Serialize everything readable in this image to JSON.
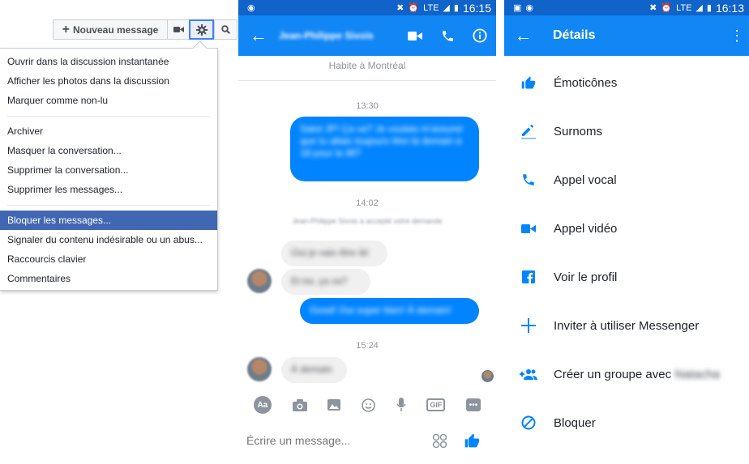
{
  "desktop": {
    "new_message_label": "Nouveau message",
    "menu_group1": [
      "Ouvrir dans la discussion instantanée",
      "Afficher les photos dans la discussion",
      "Marquer comme non-lu"
    ],
    "menu_group2": [
      "Archiver",
      "Masquer la conversation...",
      "Supprimer la conversation...",
      "Supprimer les messages..."
    ],
    "menu_selected": "Bloquer les messages...",
    "menu_group3": [
      "Signaler du contenu indésirable ou un abus...",
      "Raccourcis clavier",
      "Commentaires"
    ],
    "accent_color": "#4267b2"
  },
  "chat": {
    "status_time": "16:15",
    "network": "LTE",
    "contact_name": "Jean-Philippe Sivois",
    "location_text": "Habite à Montréal",
    "timestamps": [
      "13:30",
      "14:02",
      "15:24"
    ],
    "messages": {
      "out1": "Salut JP! Ça va? Je voulais m'assurer que tu allais toujours être là demain à 18 pour le lift?",
      "system": "Jean-Philippe Sivois a accepté votre demande",
      "in1": "Oui je vais être là!",
      "in2": "Et toi, ça va?",
      "out2": "Good! Oui super bien! À demain!",
      "in3": "À demain"
    },
    "input_placeholder": "Écrire un message...",
    "toolbar": [
      "Aa",
      "camera-icon",
      "photo-icon",
      "emoji-icon",
      "mic-icon",
      "GIF",
      "more-icon"
    ],
    "accent_color": "#0084ff"
  },
  "details": {
    "status_time": "16:13",
    "network": "LTE",
    "title": "Détails",
    "items": [
      {
        "label": "Émoticônes",
        "icon": "thumbs-up-icon"
      },
      {
        "label": "Surnoms",
        "icon": "pencil-icon"
      },
      {
        "label": "Appel vocal",
        "icon": "phone-icon"
      },
      {
        "label": "Appel vidéo",
        "icon": "video-icon"
      },
      {
        "label": "Voir le profil",
        "icon": "facebook-icon"
      },
      {
        "label": "Inviter à utiliser Messenger",
        "icon": "plus-icon"
      },
      {
        "label": "Créer un groupe avec",
        "name": "Natacha",
        "icon": "add-group-icon"
      },
      {
        "label": "Bloquer",
        "icon": "block-icon"
      }
    ]
  }
}
